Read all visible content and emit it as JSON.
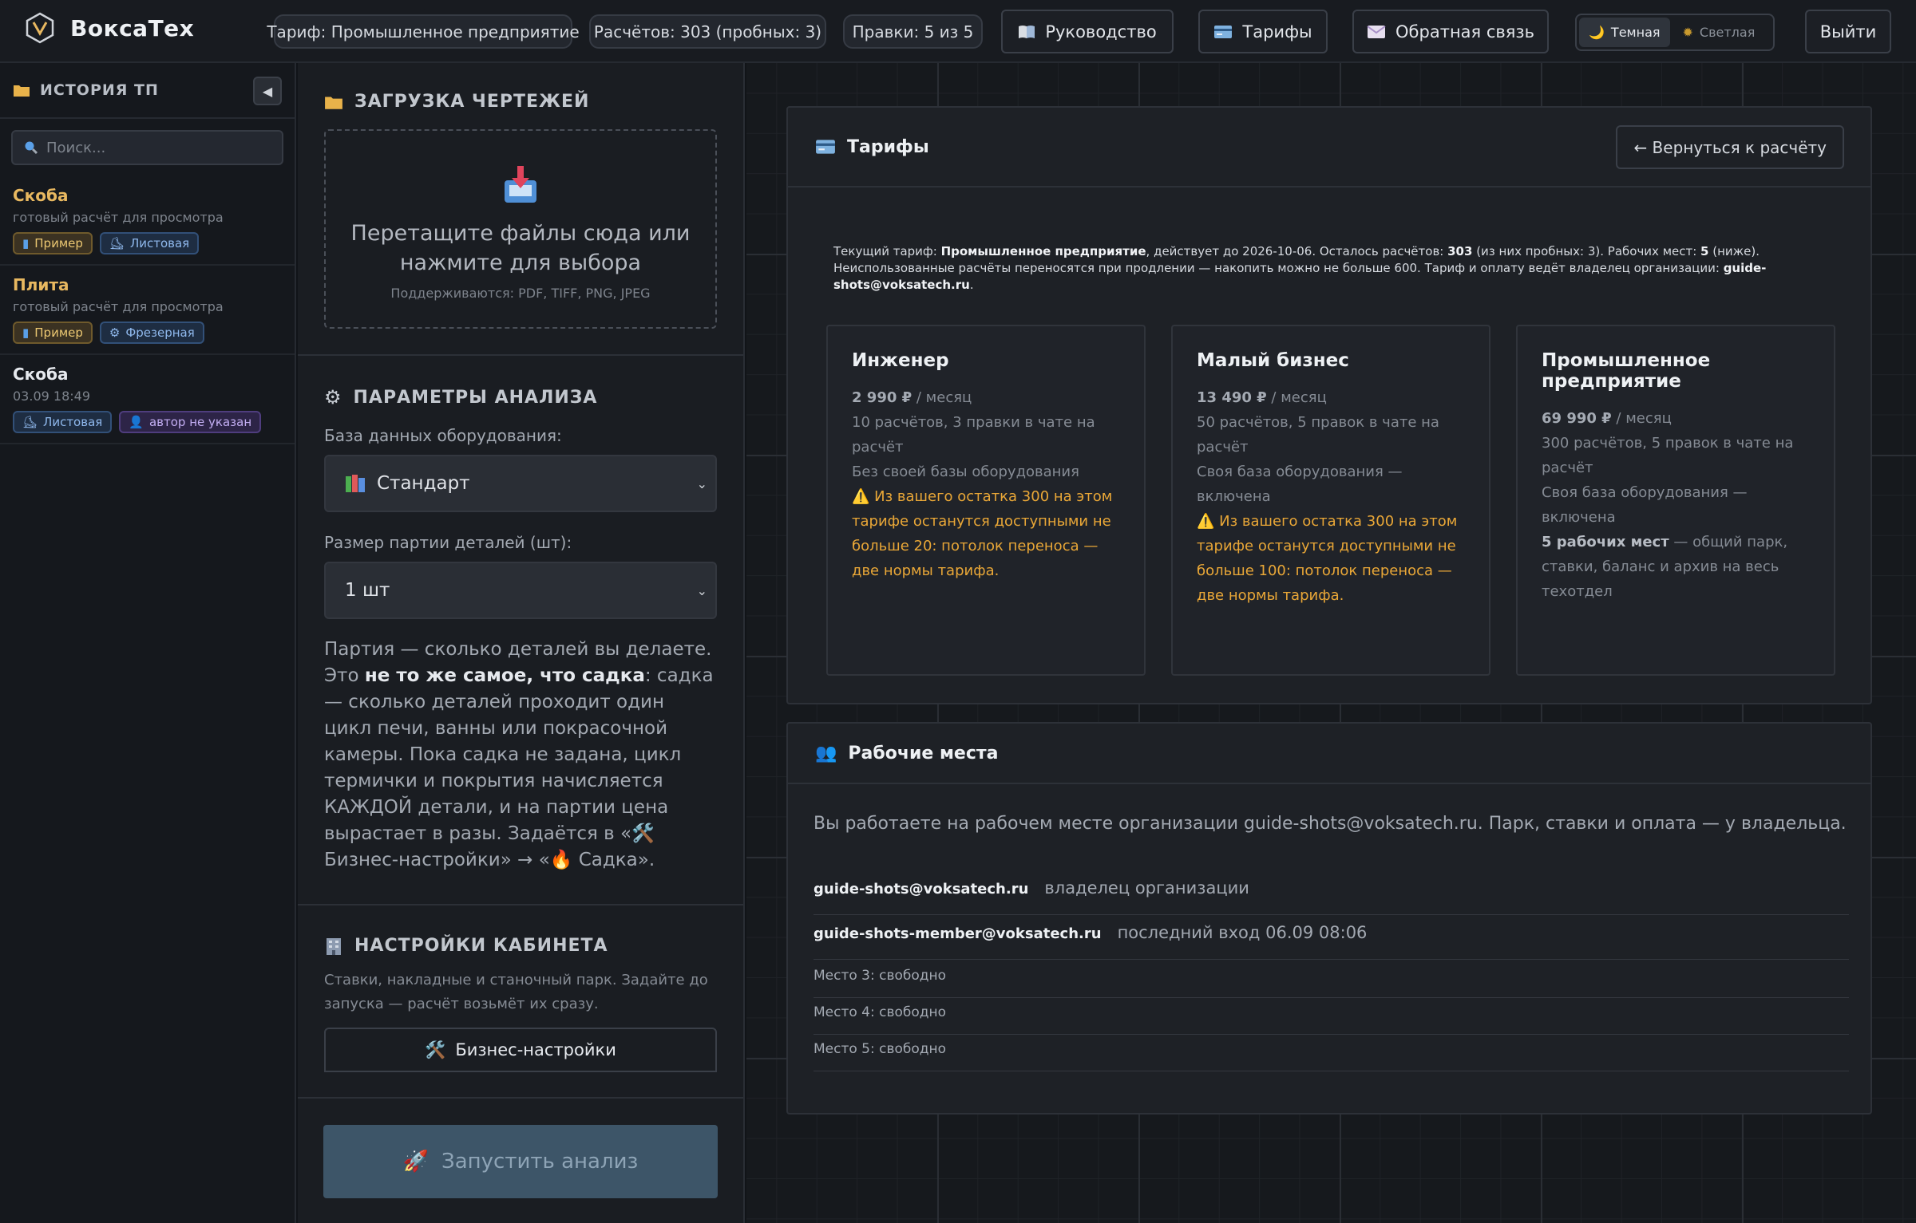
{
  "app": {
    "logo_text": "ВоксаТех",
    "logo_icon": "voxatech-logo-icon"
  },
  "topbar": {
    "tariff_pill": "Тариф: Промышленное предприятие",
    "calc_pill": "Расчётов: 303 (пробных: 3)",
    "edits_pill": "Правки: 5 из 5",
    "guide_label": "Руководство",
    "guide_icon": "book-icon",
    "tariffs_label": "Тарифы",
    "tariffs_icon": "credit-card-icon",
    "feedback_label": "Обратная связь",
    "feedback_icon": "envelope-icon",
    "theme_dark": "Темная",
    "theme_light": "Светлая",
    "logout_label": "Выйти"
  },
  "sidebar": {
    "title": "ИСТОРИЯ ТП",
    "search_placeholder": "Поиск...",
    "items": [
      {
        "title": "Скоба",
        "subtitle": "готовый расчёт для просмотра",
        "tags": [
          "Пример",
          "Листовая"
        ]
      },
      {
        "title": "Плита",
        "subtitle": "готовый расчёт для просмотра",
        "tags": [
          "Пример",
          "Фрезерная"
        ]
      },
      {
        "title": "Скоба",
        "subtitle": "03.09 18:49",
        "tags": [
          "Листовая",
          "автор не указан"
        ]
      }
    ]
  },
  "upload": {
    "heading": "ЗАГРУЗКА ЧЕРТЕЖЕЙ",
    "drop_text": "Перетащите файлы сюда или нажмите для выбора",
    "formats": "Поддерживаются: PDF, TIFF, PNG, JPEG"
  },
  "params": {
    "heading": "ПАРАМЕТРЫ АНАЛИЗА",
    "db_label": "База данных оборудования:",
    "db_value": "Стандарт",
    "batch_label": "Размер партии деталей (шт):",
    "batch_value": "1 шт",
    "note_1": "Партия — сколько деталей вы делаете. Это ",
    "note_bold": "не то же самое, что садка",
    "note_2": ": садка — сколько деталей проходит один цикл печи, ванны или покрасочной камеры. Пока садка не задана, цикл термички и покрытия начисляется КАЖДОЙ детали, и на партии цена вырастает в разы. Задаётся в «🛠️ Бизнес-настройки» → «🔥 Садка»."
  },
  "cabinet": {
    "heading": "НАСТРОЙКИ КАБИНЕТА",
    "desc": "Ставки, накладные и станочный парк. Задайте до запуска — расчёт возьмёт их сразу.",
    "biz_button": "Бизнес-настройки",
    "run_button": "Запустить анализ"
  },
  "tariffs_card": {
    "title": "Тарифы",
    "back_button": "← Вернуться к расчёту",
    "info_1": "Текущий тариф: ",
    "info_plan": "Промышленное предприятие",
    "info_2": ", действует до 2026-10-06. Осталось расчётов: ",
    "info_calcs": "303",
    "info_3": " (из них пробных: 3). Рабочих мест: ",
    "info_seats": "5",
    "info_4": " (ниже).",
    "info_5": "Неиспользованные расчёты переносятся при продлении — накопить можно не больше 600. Тариф и оплату ведёт владелец организации: ",
    "info_email": "guide-shots@voksatech.ru",
    "info_6": ".",
    "plans": [
      {
        "name": "Инженер",
        "price": "2 990 ₽",
        "period": " / месяц",
        "limits": "10 расчётов, 3 правки в чате на расчёт",
        "db": "Без своей базы оборудования",
        "warning": "⚠️ Из вашего остатка 300 на этом тарифе останутся доступными не больше 20: потолок переноса — две нормы тарифа."
      },
      {
        "name": "Малый бизнес",
        "price": "13 490 ₽",
        "period": " / месяц",
        "limits": "50 расчётов, 5 правок в чате на расчёт",
        "db": "Своя база оборудования — включена",
        "warning": "⚠️ Из вашего остатка 300 на этом тарифе останутся доступными не больше 100: потолок переноса — две нормы тарифа."
      },
      {
        "name": "Промышленное предприятие",
        "price": "69 990 ₽",
        "period": " / месяц",
        "limits": "300 расчётов, 5 правок в чате на расчёт",
        "db": "Своя база оборудования — включена",
        "seats_bold": "5 рабочих мест",
        "seats_rest": " — общий парк, ставки, баланс и архив на весь техотдел"
      }
    ]
  },
  "workspaces": {
    "title": "Рабочие места",
    "intro": "Вы работаете на рабочем месте организации guide-shots@voksatech.ru. Парк, ставки и оплата — у владельца.",
    "members": [
      {
        "email": "guide-shots@voksatech.ru",
        "role": "владелец организации"
      },
      {
        "email": "guide-shots-member@voksatech.ru",
        "role": "последний вход 06.09 08:06"
      }
    ],
    "free_slots": [
      "Место 3: свободно",
      "Место 4: свободно",
      "Место 5: свободно"
    ]
  },
  "colors": {
    "accent_yellow": "#e8b860",
    "warning_orange": "#e9a737",
    "run_button_bg": "#3d5568"
  }
}
